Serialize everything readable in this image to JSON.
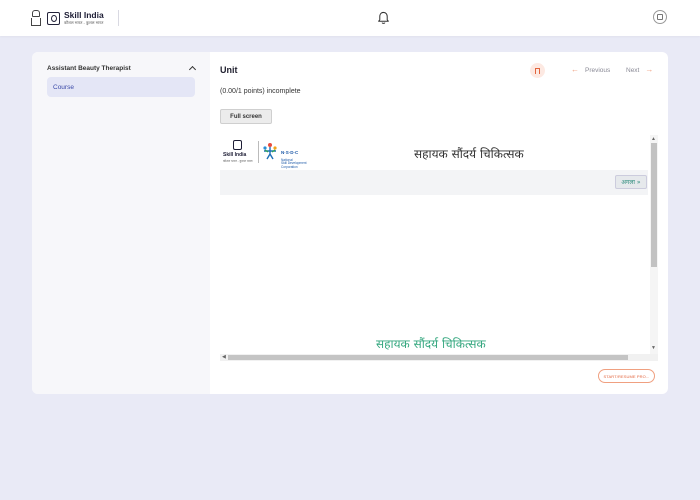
{
  "header": {
    "logo_title": "Skill India",
    "logo_subtitle": "कौशल भारत - कुशल भारत",
    "icons": [
      "emblem-icon",
      "skill-india-mark-icon",
      "bell-icon",
      "profile-icon"
    ]
  },
  "sidebar": {
    "section_title": "Assistant Beauty Therapist",
    "items": [
      {
        "label": "Course",
        "selected": true
      }
    ]
  },
  "main": {
    "title": "Unit",
    "prev_label": "Previous",
    "next_label": "Next",
    "progress_text": "(0.00/1 points) incomplete",
    "fullscreen_label": "Full screen",
    "action_button_label": "START/RESUME PRO..."
  },
  "embedded": {
    "logo1_title": "Skill India",
    "logo1_subtitle": "कौशल भारत - कुशल भारत",
    "logo2_title": "N·S·D·C",
    "logo2_line1": "National",
    "logo2_line2": "Skill Development",
    "logo2_line3": "Corporation",
    "heading": "सहायक सौंदर्य चिकित्सक",
    "next_link_label": "अगला »",
    "bottom_text": "सहायक सौंदर्य चिकित्सक"
  },
  "colors": {
    "accent": "#e2643c",
    "sidebar_selected": "#e4e6f6",
    "page_bg": "#e9eaf6",
    "embedded_green": "#35a77f"
  }
}
